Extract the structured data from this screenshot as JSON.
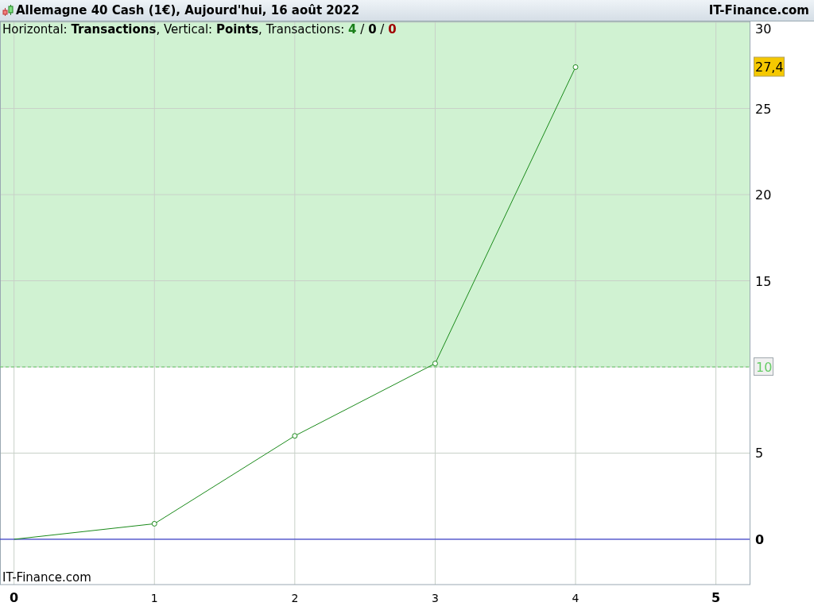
{
  "header": {
    "title": "Allemagne 40 Cash (1€), Aujourd'hui, 16 août 2022",
    "brand": "IT-Finance.com"
  },
  "chart": {
    "subtitle": "Horizontal: **Transactions**, Vertical: **Points**, Transactions: ",
    "counts": [
      {
        "value": "4",
        "color": "#1a7f1a"
      },
      {
        "value": "0",
        "color": "#000000"
      },
      {
        "value": "0",
        "color": "#a00000"
      }
    ],
    "separator": " / ",
    "watermark": "IT-Finance.com",
    "chart_data": {
      "type": "line",
      "x": [
        0,
        1,
        2,
        3,
        4
      ],
      "series": [
        {
          "color": "#1a8a1a",
          "marker": "o",
          "values": [
            0,
            0.9,
            6.0,
            10.2,
            27.4
          ]
        }
      ],
      "grid": true,
      "xlim": [
        -0.1,
        5.24
      ],
      "ylim": [
        -2.63,
        30.05
      ],
      "xticks": [
        0,
        1,
        2,
        3,
        4,
        5
      ],
      "yticks": [
        0,
        5,
        10,
        15,
        20,
        25,
        30
      ],
      "annotations": [
        "27,4"
      ],
      "ref_lines": [
        {
          "axis": "y",
          "value": 10,
          "label": "10",
          "color": "#66cc66"
        },
        {
          "axis": "y",
          "value": 0,
          "color": "#2020d0"
        }
      ],
      "bands": [
        {
          "axis": "y",
          "from": 10,
          "to": 30.05,
          "color": "#d0f2d2"
        }
      ]
    }
  }
}
